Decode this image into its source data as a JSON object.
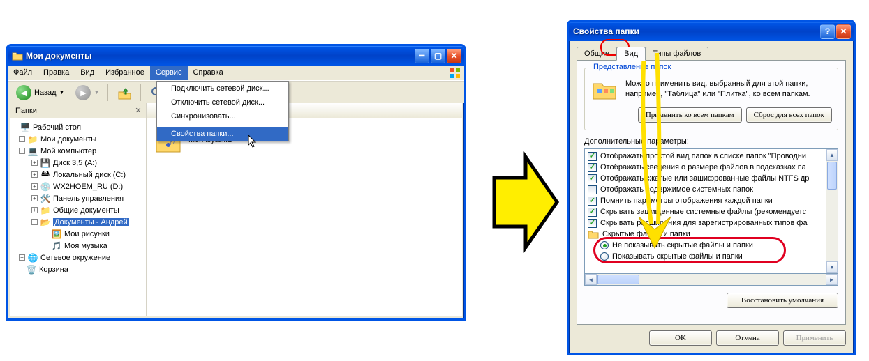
{
  "explorer": {
    "title": "Мои документы",
    "menu": {
      "file": "Файл",
      "edit": "Правка",
      "view": "Вид",
      "favorites": "Избранное",
      "tools": "Сервис",
      "help": "Справка"
    },
    "tools_menu": {
      "map_drive": "Подключить сетевой диск...",
      "disconnect_drive": "Отключить сетевой диск...",
      "sync": "Синхронизовать...",
      "folder_options": "Свойства папки..."
    },
    "toolbar": {
      "back": "Назад"
    },
    "sidebar": {
      "header": "Папки",
      "tree": {
        "desktop": "Рабочий стол",
        "mydocs": "Мои документы",
        "mycomp": "Мой компьютер",
        "floppy": "Диск 3,5 (A:)",
        "localc": "Локальный диск (C:)",
        "cdrom": "WX2HOEM_RU (D:)",
        "ctrlpanel": "Панель управления",
        "shareddocs": "Общие документы",
        "andreydocs": "Документы - Андрей",
        "mypics": "Мои рисунки",
        "mymusic": "Моя музыка",
        "netplaces": "Сетевое окружение",
        "recycle": "Корзина"
      }
    },
    "content": {
      "mymusic": "Моя музыка"
    }
  },
  "dialog": {
    "title": "Свойства папки",
    "tabs": {
      "general": "Общие",
      "view": "Вид",
      "filetypes": "Типы файлов"
    },
    "group1": {
      "title": "Представление папок",
      "text": "Можно применить вид, выбранный для этой папки, например, \"Таблица\" или \"Плитка\", ко всем папкам.",
      "apply_all": "Применить ко всем папкам",
      "reset_all": "Сброс для всех папок"
    },
    "adv_label": "Дополнительные параметры:",
    "adv": {
      "simple": "Отображать простой вид папок в списке папок \"Проводни",
      "size_hints": "Отображать сведения о размере файлов в подсказках па",
      "ntfs": "Отображать сжатые или зашифрованные файлы NTFS др",
      "sys_folders": "Отображать содержимое системных папок",
      "remember": "Помнить параметры отображения каждой папки",
      "hide_protected": "Скрывать защищенные системные файлы (рекомендуетс",
      "hide_ext": "Скрывать расширения для зарегистрированных типов фа",
      "hidden_group": "Скрытые файлы и папки",
      "dont_show": "Не показывать скрытые файлы и папки",
      "show": "Показывать скрытые файлы и папки"
    },
    "restore": "Восстановить умолчания",
    "ok": "OK",
    "cancel": "Отмена",
    "apply": "Применить"
  }
}
